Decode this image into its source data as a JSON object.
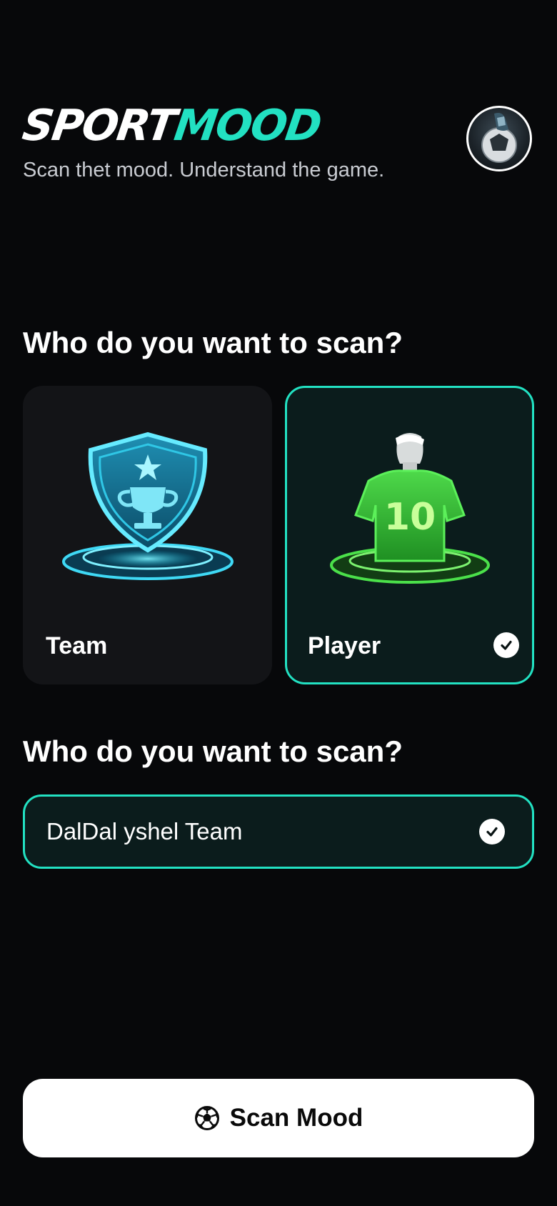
{
  "header": {
    "brand_part1": "SPORT",
    "brand_part2": "MOOD",
    "tagline": "Scan thet mood. Understand the game."
  },
  "section1": {
    "title": "Who do you want to scan?",
    "options": [
      {
        "label": "Team",
        "selected": false,
        "icon": "trophy-shield-icon"
      },
      {
        "label": "Player",
        "selected": true,
        "icon": "player-jersey-icon",
        "jersey_number": "10"
      }
    ]
  },
  "section2": {
    "title": "Who do you want to scan?",
    "selected_value": "DalDal yshel Team"
  },
  "cta": {
    "label": "Scan Mood",
    "icon": "soccer-ball-icon"
  },
  "colors": {
    "accent": "#22e1c2",
    "background": "#07080a",
    "card": "#131417",
    "selected_card": "#0b1c1c"
  }
}
